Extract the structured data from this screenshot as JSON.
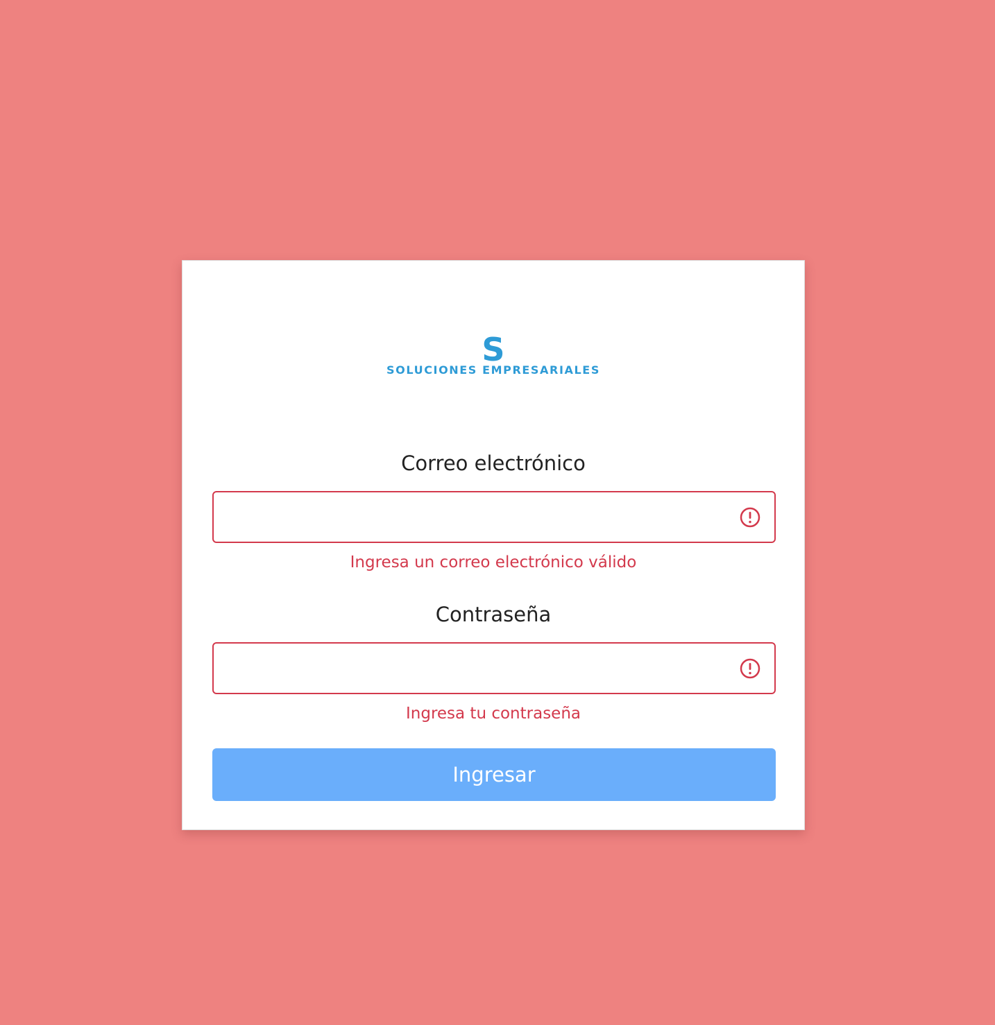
{
  "brand": {
    "mark": "S",
    "name": "SOLUCIONES EMPRESARIALES",
    "color": "#2e9bd6"
  },
  "form": {
    "email": {
      "label": "Correo electrónico",
      "value": "",
      "error": "Ingresa un correo electrónico válido"
    },
    "password": {
      "label": "Contraseña",
      "value": "",
      "error": "Ingresa tu contraseña"
    },
    "submit_label": "Ingresar"
  },
  "colors": {
    "background": "#ee8280",
    "error": "#d3394c",
    "button": "#6aaefb"
  },
  "icons": {
    "field_status": "exclamation-circle-icon"
  }
}
